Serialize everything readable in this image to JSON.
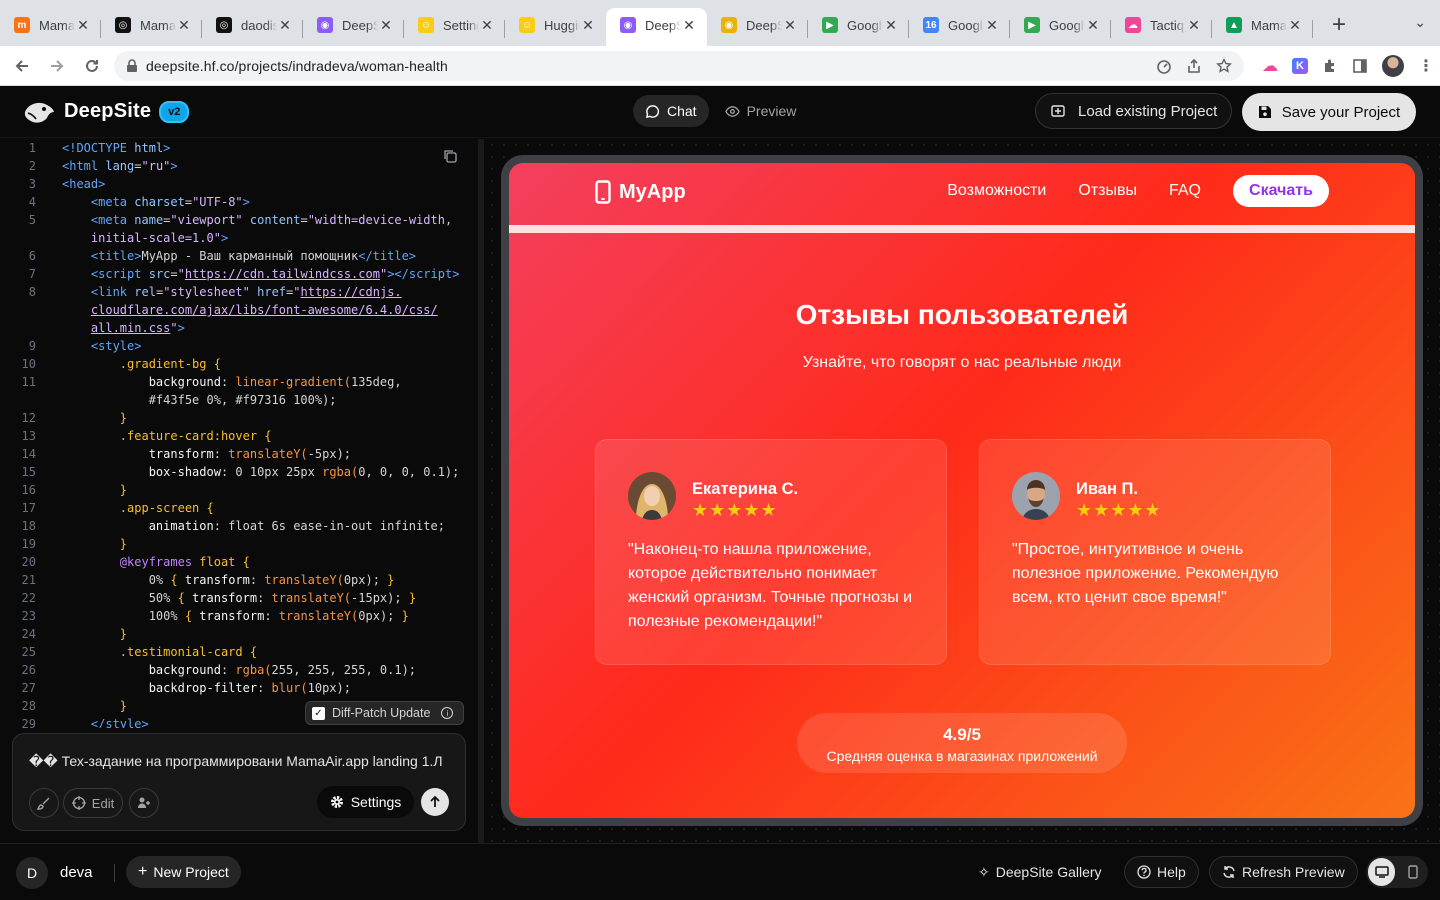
{
  "browser": {
    "tabs": [
      {
        "title": "MamaAir",
        "favicon_color": "#f97316",
        "favicon_glyph": "m"
      },
      {
        "title": "MamaAir",
        "favicon_color": "#111111",
        "favicon_glyph": "◎"
      },
      {
        "title": "daodis",
        "favicon_color": "#111111",
        "favicon_glyph": "◎"
      },
      {
        "title": "DeepSite",
        "favicon_color": "#8b5cf6",
        "favicon_glyph": "◉"
      },
      {
        "title": "Settings",
        "favicon_color": "#facc15",
        "favicon_glyph": "☺"
      },
      {
        "title": "Hugging",
        "favicon_color": "#facc15",
        "favicon_glyph": "☺"
      },
      {
        "title": "DeepSite",
        "favicon_color": "#8b5cf6",
        "favicon_glyph": "◉"
      },
      {
        "title": "DeepSite",
        "favicon_color": "#eab308",
        "favicon_glyph": "◉"
      },
      {
        "title": "Google",
        "favicon_color": "#34a853",
        "favicon_glyph": "▶"
      },
      {
        "title": "Google",
        "favicon_color": "#4285f4",
        "favicon_glyph": "16"
      },
      {
        "title": "Google",
        "favicon_color": "#34a853",
        "favicon_glyph": "▶"
      },
      {
        "title": "Tactiq",
        "favicon_color": "#ec4899",
        "favicon_glyph": "☁"
      },
      {
        "title": "MamaAir",
        "favicon_color": "#0f9d58",
        "favicon_glyph": "▲"
      }
    ],
    "active_tab_index": 6,
    "url": "deepsite.hf.co/projects/indradeva/woman-health"
  },
  "app": {
    "brand": "DeepSite",
    "version_badge": "v2",
    "view_toggle": {
      "chat": "Chat",
      "preview": "Preview"
    },
    "load_button": "Load existing Project",
    "save_button": "Save your Project"
  },
  "editor": {
    "line_numbers": [
      "1",
      "2",
      "3",
      "4",
      "5",
      "",
      "6",
      "7",
      "8",
      "",
      "",
      "9",
      "10",
      "11",
      "",
      "12",
      "13",
      "14",
      "15",
      "16",
      "17",
      "18",
      "19",
      "20",
      "21",
      "22",
      "23",
      "24",
      "25",
      "26",
      "27",
      "28",
      "29"
    ],
    "diff_patch_label": "Diff-Patch Update",
    "diff_patch_checked": true
  },
  "prompt": {
    "text": "�� Тех-задание на программировани MamaAir.app landing 1.Л",
    "edit_label": "Edit",
    "settings_label": "Settings"
  },
  "site": {
    "logo": "MyApp",
    "nav_links": [
      "Возможности",
      "Отзывы",
      "FAQ"
    ],
    "download_button": "Скачать",
    "section_title": "Отзывы пользователей",
    "section_subtitle": "Узнайте, что говорят о нас реальные люди",
    "testimonials": [
      {
        "name": "Екатерина С.",
        "stars": "★★★★★",
        "quote": "\"Наконец-то нашла приложение, которое действительно понимает женский организм. Точные прогнозы и полезные рекомендации!\""
      },
      {
        "name": "Иван П.",
        "stars": "★★★★★",
        "quote": "\"Простое, интуитивное и очень полезное приложение. Рекомендую всем, кто ценит свое время!\""
      }
    ],
    "rating_value": "4.9/5",
    "rating_label": "Средняя оценка в магазинах приложений",
    "gradient_from": "#f43f5e",
    "gradient_to": "#f97316"
  },
  "footer": {
    "user_initial": "D",
    "user_name": "deva",
    "new_project": "New Project",
    "gallery": "DeepSite Gallery",
    "help": "Help",
    "refresh": "Refresh Preview"
  }
}
